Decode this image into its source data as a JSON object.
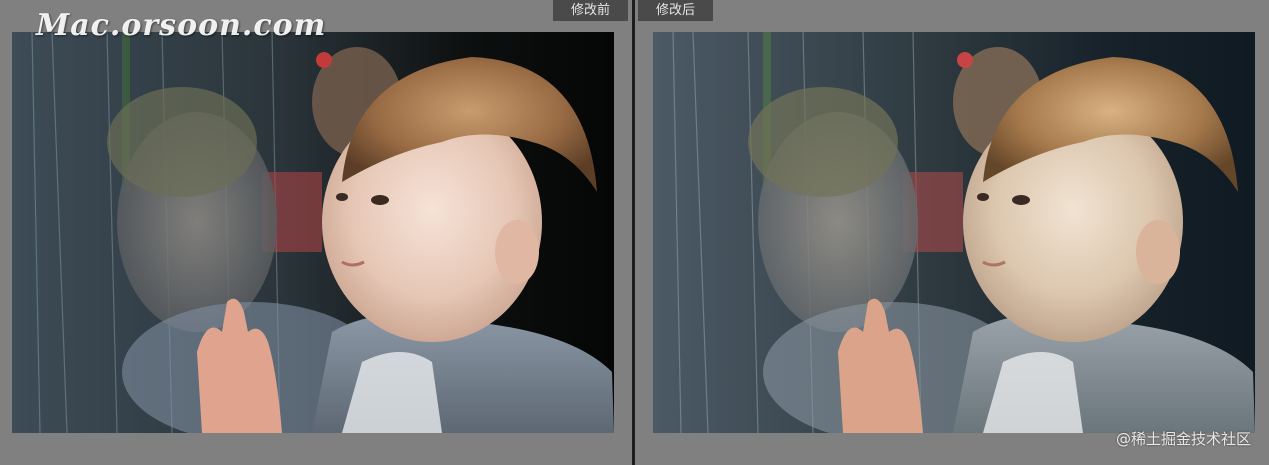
{
  "labels": {
    "before": "修改前",
    "after": "修改后"
  },
  "watermark": {
    "site": "Mac.orsoon.com",
    "credit": "@稀土掘金技术社区"
  },
  "colors": {
    "background": "#808080",
    "divider": "#1e1e1e",
    "label_bg": "#4a4a4a",
    "label_text": "#e6e6e6"
  },
  "images": {
    "before": {
      "description_icon": "photo-before-icon"
    },
    "after": {
      "description_icon": "photo-after-icon"
    }
  }
}
